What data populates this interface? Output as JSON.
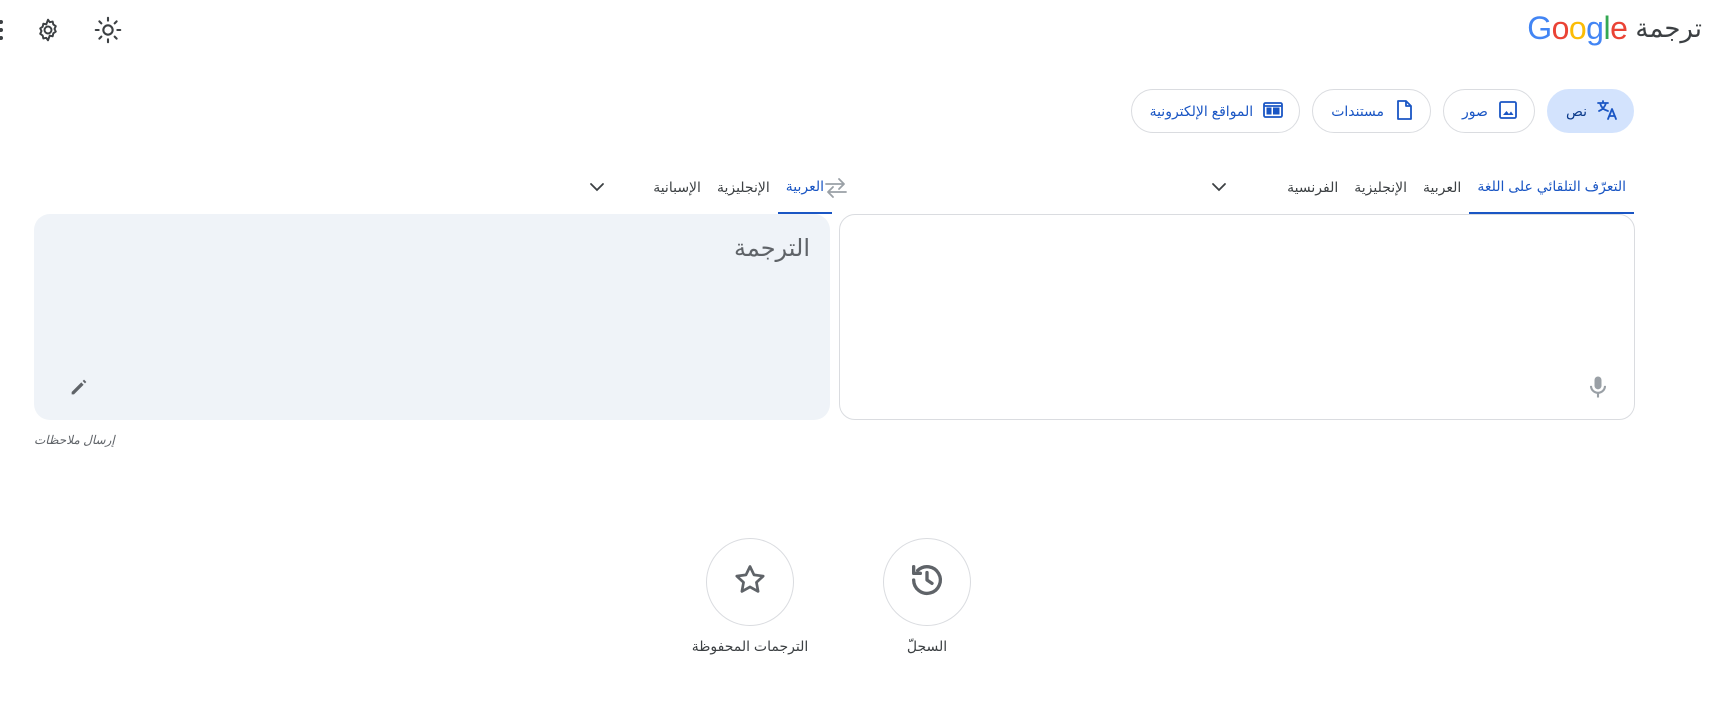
{
  "header": {
    "logo": [
      "G",
      "o",
      "o",
      "g",
      "l",
      "e"
    ],
    "product": "ترجمة",
    "icons": [
      "more-vert-icon",
      "settings-gear-icon",
      "sun-icon"
    ]
  },
  "modes": [
    {
      "label": "نص",
      "icon": "translate-icon",
      "active": true
    },
    {
      "label": "صور",
      "icon": "image-icon",
      "active": false
    },
    {
      "label": "مستندات",
      "icon": "document-icon",
      "active": false
    },
    {
      "label": "المواقع الإلكترونية",
      "icon": "website-icon",
      "active": false
    }
  ],
  "source_languages": [
    "التعرّف التلقائي على اللغة",
    "العربية",
    "الإنجليزية",
    "الفرنسية"
  ],
  "target_languages": [
    "العربية",
    "الإنجليزية",
    "الإسبانية"
  ],
  "source_panel": {
    "value": ""
  },
  "target_panel": {
    "placeholder": "الترجمة"
  },
  "feedback": "إرسال ملاحظات",
  "shortcuts": {
    "history": "السجلّ",
    "saved": "الترجمات المحفوظة"
  },
  "colors": {
    "accent": "#1a56c4",
    "active_chip_bg": "#d3e3fd",
    "target_panel_bg": "#eff3f8"
  }
}
